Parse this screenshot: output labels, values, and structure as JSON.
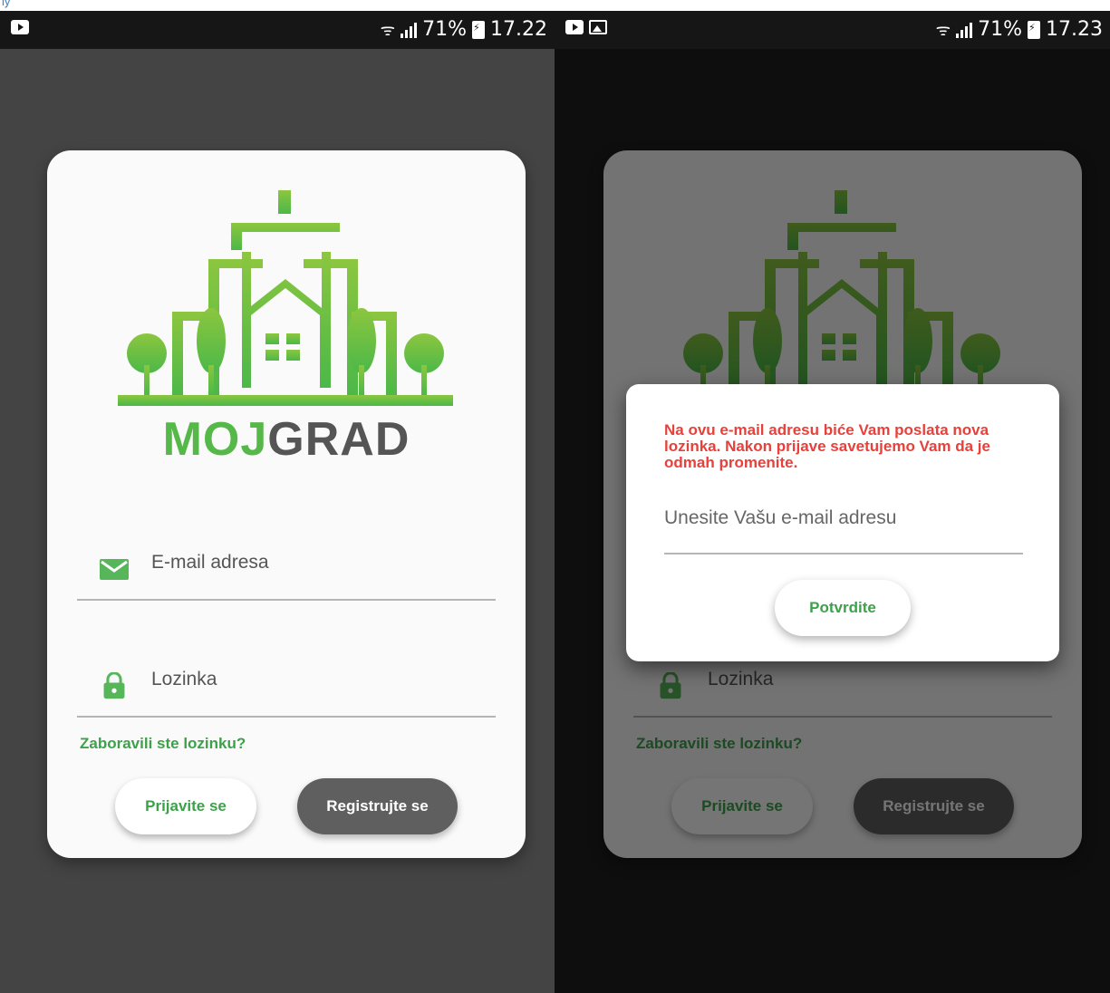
{
  "caption": "ly",
  "status_left": {
    "time": "17.22",
    "battery": "71%"
  },
  "status_right": {
    "time": "17.23",
    "battery": "71%"
  },
  "brand": {
    "moj": "MOJ",
    "grad": "GRAD"
  },
  "login": {
    "email_placeholder": "E-mail adresa",
    "password_placeholder": "Lozinka",
    "forgot_password": "Zaboravili ste lozinku?",
    "login_button": "Prijavite se",
    "register_button": "Registrujte se"
  },
  "dialog": {
    "message": "Na ovu e-mail adresu biće Vam poslata nova lozinka. Nakon prijave savetujemo Vam da je odmah promenite.",
    "input_placeholder": "Unesite Vašu e-mail adresu",
    "confirm_button": "Potvrdite"
  },
  "colors": {
    "accent": "#3da14a",
    "logo_green": "#7cc242",
    "error": "#e8403a"
  },
  "icons": [
    "youtube-icon",
    "gallery-icon",
    "wifi-icon",
    "signal-icon",
    "battery-icon",
    "mail-icon",
    "lock-icon"
  ]
}
